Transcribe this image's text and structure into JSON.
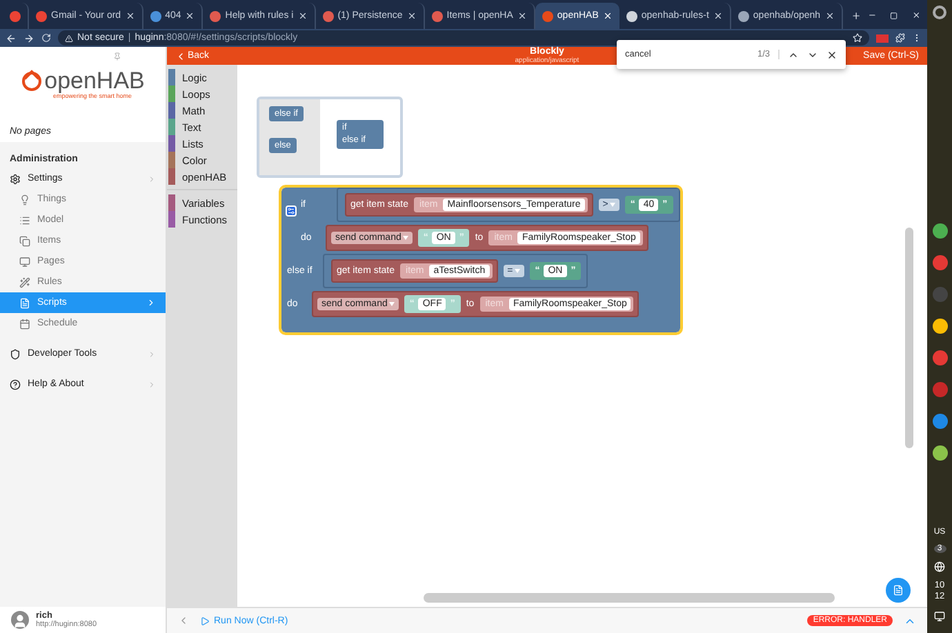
{
  "browser": {
    "tabs": [
      {
        "label": "Gmail - Your ord",
        "selected": false
      },
      {
        "label": "404",
        "selected": false
      },
      {
        "label": "Help with rules i",
        "selected": false
      },
      {
        "label": "(1) Persistence",
        "selected": false
      },
      {
        "label": "Items | openHA",
        "selected": false
      },
      {
        "label": "openHAB",
        "selected": true
      },
      {
        "label": "openhab-rules-t",
        "selected": false
      },
      {
        "label": "openhab/openh",
        "selected": false
      }
    ],
    "security": "Not secure",
    "separator": "|",
    "host": "huginn",
    "path": ":8080/#!/settings/scripts/blockly"
  },
  "header": {
    "back": "Back",
    "title": "Blockly",
    "subtitle": "application/javascript",
    "save": "Save (Ctrl-S)"
  },
  "find_bar": {
    "query": "cancel",
    "count": "1/3"
  },
  "sidebar": {
    "logo": "openHAB",
    "tagline": "empowering the smart home",
    "pages_note": "No pages",
    "section": "Administration",
    "items": [
      {
        "label": "Settings",
        "selected": false,
        "children": [
          {
            "label": "Things",
            "selected": false
          },
          {
            "label": "Model",
            "selected": false
          },
          {
            "label": "Items",
            "selected": false
          },
          {
            "label": "Pages",
            "selected": false
          },
          {
            "label": "Rules",
            "selected": false
          },
          {
            "label": "Scripts",
            "selected": true
          },
          {
            "label": "Schedule",
            "selected": false
          }
        ]
      },
      {
        "label": "Developer Tools",
        "selected": false
      },
      {
        "label": "Help & About",
        "selected": false
      }
    ],
    "user": {
      "name": "rich",
      "url": "http://huginn:8080"
    }
  },
  "toolbox": {
    "groups": [
      {
        "categories": [
          {
            "label": "Logic",
            "color": "#5b80a5"
          },
          {
            "label": "Loops",
            "color": "#5ba55b"
          },
          {
            "label": "Math",
            "color": "#5b67a5"
          },
          {
            "label": "Text",
            "color": "#5ba58c"
          },
          {
            "label": "Lists",
            "color": "#745ba5"
          },
          {
            "label": "Color",
            "color": "#a5745b"
          },
          {
            "label": "openHAB",
            "color": "#a55b5b"
          }
        ]
      },
      {
        "categories": [
          {
            "label": "Variables",
            "color": "#a55b80"
          },
          {
            "label": "Functions",
            "color": "#995ba5"
          }
        ]
      }
    ]
  },
  "workspace": {
    "flyout": {
      "palette": [
        "else if",
        "else"
      ],
      "preview": [
        "if",
        "else if"
      ]
    },
    "main_block": {
      "selected": true,
      "clauses": [
        {
          "keyword": "if",
          "do_label": "do",
          "condition": {
            "getter": "get item state",
            "item_label": "item",
            "item": "Mainfloorsensors_Temperature",
            "operator": ">",
            "quotes": [
              "“",
              "”"
            ],
            "value": "40"
          },
          "action": {
            "command": "send command",
            "quotes": [
              "“",
              "”"
            ],
            "value": "ON",
            "to": "to",
            "item_label": "item",
            "item": "FamilyRoomspeaker_Stop"
          }
        },
        {
          "keyword": "else if",
          "do_label": "do",
          "condition": {
            "getter": "get item state",
            "item_label": "item",
            "item": "aTestSwitch",
            "operator": "=",
            "quotes": [
              "“",
              "”"
            ],
            "value": "ON"
          },
          "action": {
            "command": "send command",
            "quotes": [
              "“",
              "”"
            ],
            "value": "OFF",
            "to": "to",
            "item_label": "item",
            "item": "FamilyRoomspeaker_Stop"
          }
        }
      ]
    }
  },
  "bottom_bar": {
    "run": "Run Now (Ctrl-R)",
    "error": "ERROR: HANDLER"
  },
  "taskbar": {
    "keyboard": "US",
    "notifications": "3",
    "clock": [
      "10",
      "12"
    ]
  }
}
